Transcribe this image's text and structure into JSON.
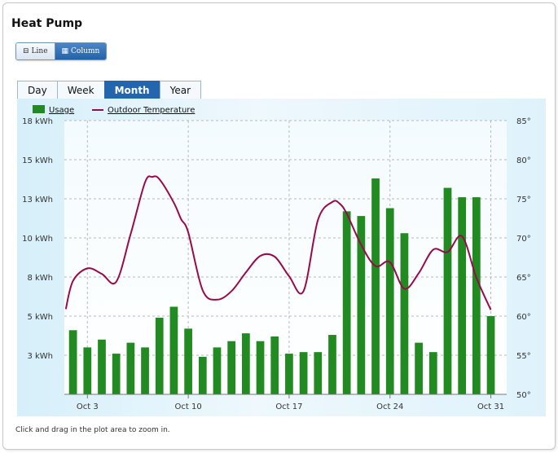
{
  "title": "Heat Pump",
  "view_toggle": {
    "line_label": "Line",
    "column_label": "Column",
    "selected": "Column"
  },
  "tabs": [
    {
      "label": "Day",
      "active": false
    },
    {
      "label": "Week",
      "active": false
    },
    {
      "label": "Month",
      "active": true
    },
    {
      "label": "Year",
      "active": false
    }
  ],
  "footnote": "Click and drag in the plot area to zoom in.",
  "colors": {
    "usage": "#218a21",
    "temperature": "#990a4d",
    "tab_active": "#2466ad"
  },
  "chart_data": {
    "type": "bar",
    "x": [
      2,
      3,
      4,
      5,
      6,
      7,
      8,
      9,
      10,
      11,
      12,
      13,
      14,
      15,
      16,
      17,
      18,
      19,
      20,
      21,
      22,
      23,
      24,
      25,
      26,
      27,
      28,
      29,
      30,
      31
    ],
    "x_ticks": [
      {
        "value": 3,
        "label": "Oct 3"
      },
      {
        "value": 10,
        "label": "Oct 10"
      },
      {
        "value": 17,
        "label": "Oct 17"
      },
      {
        "value": 24,
        "label": "Oct 24"
      },
      {
        "value": 31,
        "label": "Oct 31"
      }
    ],
    "xlim": [
      1.4,
      32.1
    ],
    "series": [
      {
        "name": "Usage",
        "type": "column",
        "axis": "left",
        "values": [
          4.6,
          3.5,
          4.0,
          3.1,
          3.8,
          3.5,
          5.4,
          6.1,
          4.7,
          2.9,
          3.5,
          3.9,
          4.4,
          3.9,
          4.2,
          3.1,
          3.2,
          3.2,
          4.3,
          12.2,
          11.9,
          14.3,
          12.4,
          10.8,
          3.8,
          3.2,
          13.7,
          13.1,
          13.1,
          5.5
        ]
      },
      {
        "name": "Outdoor Temperature",
        "type": "spline",
        "axis": "right",
        "x": [
          1.5,
          2,
          3,
          4,
          5,
          6,
          7,
          7.5,
          8,
          9,
          9.5,
          10,
          11,
          12,
          13,
          14,
          15,
          16,
          17,
          18,
          19,
          20,
          20.5,
          21,
          22,
          23,
          24,
          25,
          26,
          27,
          28,
          29,
          30,
          31
        ],
        "values": [
          60.9,
          64.5,
          66.1,
          65.4,
          64.4,
          70.5,
          77.1,
          77.8,
          77.5,
          74.5,
          72.4,
          70.7,
          63.3,
          62.1,
          63.2,
          65.6,
          67.7,
          67.6,
          65.1,
          63.2,
          72.3,
          74.6,
          74.4,
          73.1,
          69.1,
          66.4,
          66.9,
          63.5,
          65.5,
          68.5,
          68.2,
          70.2,
          64.9,
          60.8
        ]
      }
    ],
    "y_left": {
      "ticks": [
        {
          "value": 3.0,
          "label": "3 kWh"
        },
        {
          "value": 5.5,
          "label": "5 kWh"
        },
        {
          "value": 8.0,
          "label": "8 kWh"
        },
        {
          "value": 10.5,
          "label": "10 kWh"
        },
        {
          "value": 13.0,
          "label": "13 kWh"
        },
        {
          "value": 15.5,
          "label": "15 kWh"
        },
        {
          "value": 18.0,
          "label": "18 kWh"
        }
      ],
      "ylim": [
        0.5,
        18.0
      ]
    },
    "y_right": {
      "ticks": [
        {
          "value": 50,
          "label": "50°"
        },
        {
          "value": 55,
          "label": "55°"
        },
        {
          "value": 60,
          "label": "60°"
        },
        {
          "value": 65,
          "label": "65°"
        },
        {
          "value": 70,
          "label": "70°"
        },
        {
          "value": 75,
          "label": "75°"
        },
        {
          "value": 80,
          "label": "80°"
        },
        {
          "value": 85,
          "label": "85°"
        }
      ],
      "ylim": [
        50,
        85
      ]
    },
    "grid": true,
    "legend": "top-left"
  }
}
